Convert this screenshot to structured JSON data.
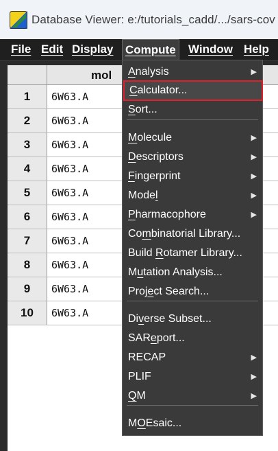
{
  "window": {
    "title": "Database Viewer: e:/tutorials_cadd/.../sars-cov"
  },
  "menubar": {
    "items": [
      "File",
      "Edit",
      "Display",
      "Compute",
      "Window",
      "Help"
    ],
    "active": "Compute"
  },
  "table": {
    "column_header": "mol",
    "rows": [
      {
        "num": "1",
        "mol": "6W63.A"
      },
      {
        "num": "2",
        "mol": "6W63.A"
      },
      {
        "num": "3",
        "mol": "6W63.A"
      },
      {
        "num": "4",
        "mol": "6W63.A"
      },
      {
        "num": "5",
        "mol": "6W63.A"
      },
      {
        "num": "6",
        "mol": "6W63.A"
      },
      {
        "num": "7",
        "mol": "6W63.A"
      },
      {
        "num": "8",
        "mol": "6W63.A"
      },
      {
        "num": "9",
        "mol": "6W63.A"
      },
      {
        "num": "10",
        "mol": "6W63.A"
      }
    ]
  },
  "compute_menu": {
    "items": [
      {
        "label": "Analysis",
        "submenu": true
      },
      {
        "label": "Calculator...",
        "submenu": false,
        "highlighted": true
      },
      {
        "label": "Sort...",
        "submenu": false
      },
      {
        "label": "Molecule",
        "submenu": true
      },
      {
        "label": "Descriptors",
        "submenu": true
      },
      {
        "label": "Fingerprint",
        "submenu": true
      },
      {
        "label": "Model",
        "submenu": true
      },
      {
        "label": "Pharmacophore",
        "submenu": true
      },
      {
        "label": "Combinatorial Library...",
        "submenu": false
      },
      {
        "label": "Build Rotamer Library...",
        "submenu": false
      },
      {
        "label": "Mutation Analysis...",
        "submenu": false
      },
      {
        "label": "Project Search...",
        "submenu": false
      },
      {
        "label": "Diverse Subset...",
        "submenu": false
      },
      {
        "label": "SAReport...",
        "submenu": false
      },
      {
        "label": "RECAP",
        "submenu": true
      },
      {
        "label": "PLIF",
        "submenu": true
      },
      {
        "label": "QM",
        "submenu": true
      },
      {
        "label": "MOEsaic...",
        "submenu": false
      }
    ],
    "submenu_arrow": "▶",
    "highlight_color": "#e0202a"
  }
}
